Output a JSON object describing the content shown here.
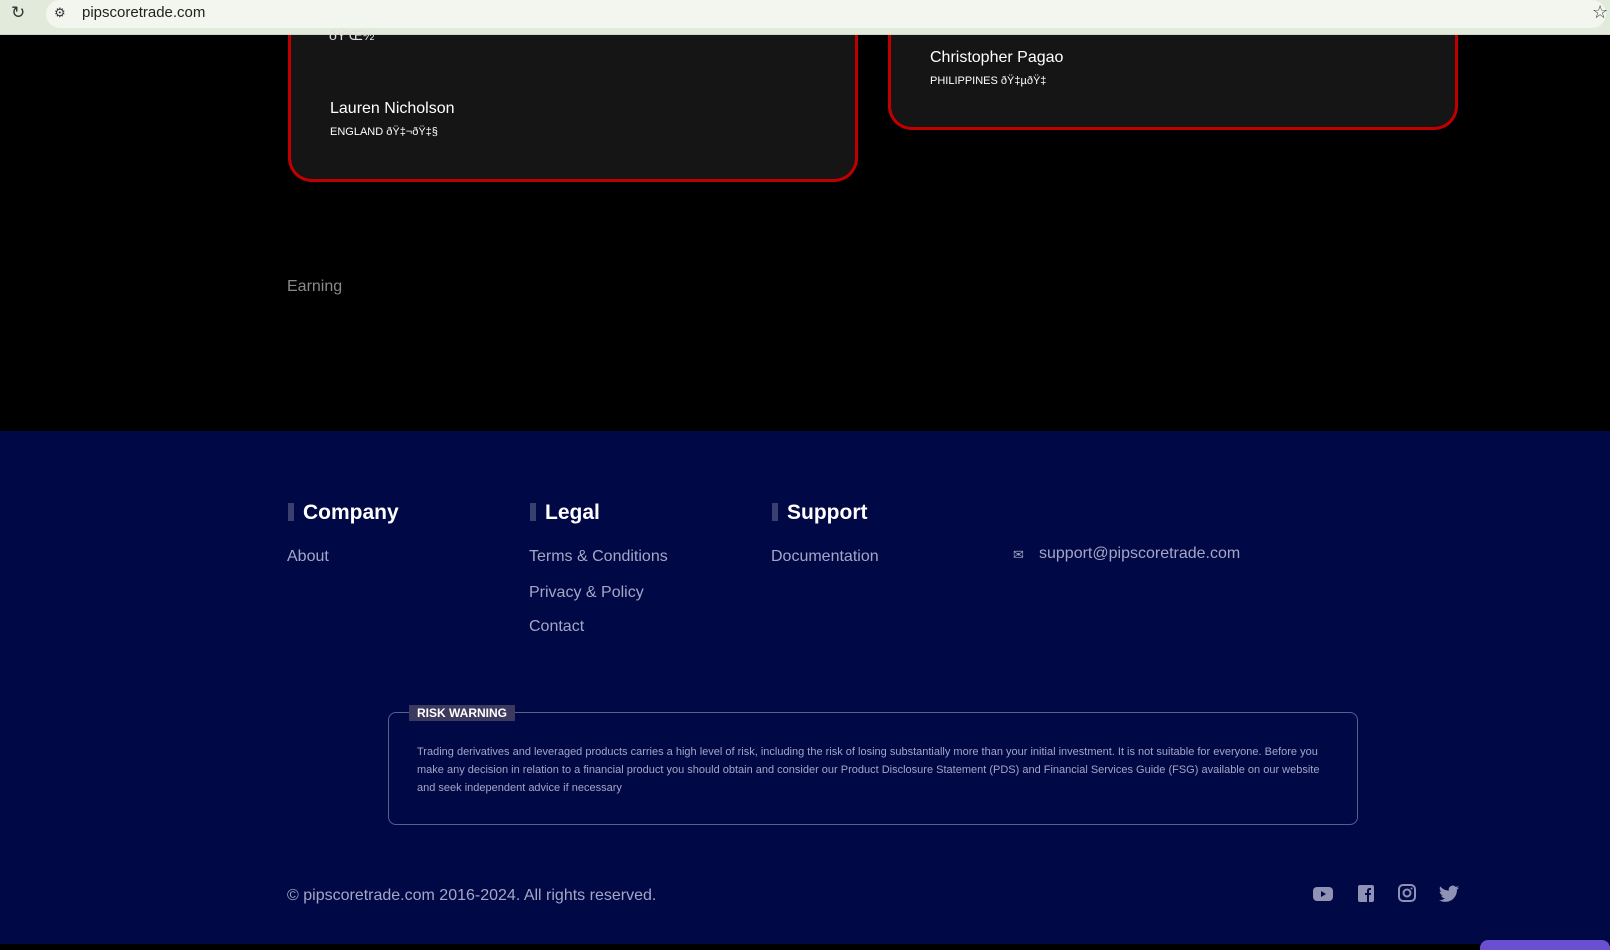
{
  "browser": {
    "url": "pipscoretrade.com"
  },
  "testimonials": [
    {
      "partial_text": "ðŸ'Œ½",
      "name": "Lauren Nicholson",
      "country": "ENGLAND ðŸ‡¬ðŸ‡§"
    },
    {
      "name": "Christopher Pagao",
      "country": "PHILIPPINES ðŸ‡µðŸ‡"
    }
  ],
  "section_label": "Earning",
  "footer": {
    "company": {
      "title": "Company",
      "links": [
        "About"
      ]
    },
    "legal": {
      "title": "Legal",
      "links": [
        "Terms & Conditions",
        "Privacy & Policy",
        "Contact"
      ]
    },
    "support": {
      "title": "Support",
      "links": [
        "Documentation"
      ]
    },
    "email": "support@pipscoretrade.com",
    "risk": {
      "label": "RISK WARNING",
      "text": "Trading derivatives and leveraged products carries a high level of risk, including the risk of losing substantially more than your initial investment. It is not suitable for everyone. Before you make any decision in relation to a financial product you should obtain and consider our Product Disclosure Statement (PDS) and Financial Services Guide (FSG) available on our website and seek independent advice if necessary"
    },
    "copyright": "© pipscoretrade.com 2016-2024. All rights reserved.",
    "social": [
      "youtube-icon",
      "facebook-icon",
      "instagram-icon",
      "twitter-icon"
    ]
  },
  "colors": {
    "accent": "#c00000",
    "footer_bg": "#000846",
    "card_bg": "#151515"
  }
}
